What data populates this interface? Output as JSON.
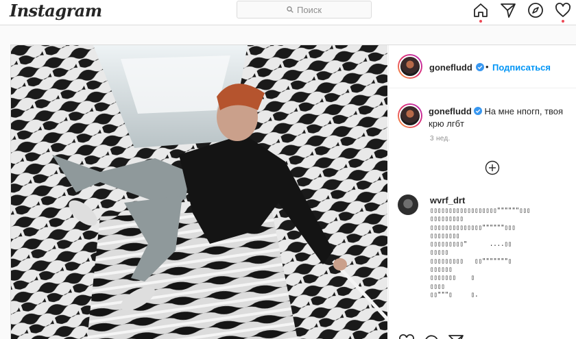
{
  "app": {
    "logo": "Instagram"
  },
  "search": {
    "placeholder": "Поиск"
  },
  "nav": {
    "icons": [
      "home-icon",
      "direct-icon",
      "explore-icon",
      "activity-heart-icon"
    ]
  },
  "colors": {
    "accent": "#0095f6",
    "notification": "#ed4956",
    "border": "#dbdbdb"
  },
  "post": {
    "author": "gonefludd",
    "follow_label": "Подписаться",
    "bullet": "•",
    "caption_user": "gonefludd",
    "caption_text": "На мне нпогп, твоя крю лгбт",
    "time": "3 нед."
  },
  "comment": {
    "user": "wvrf_drt",
    "ascii_art": "▯▯▯▯▯▯▯▯▯▯▯▯▯▯▯▯▯▯\"\"\"\"\"\"▯▯▯\n▯▯▯▯▯▯▯▯▯\n▯▯▯▯▯▯▯▯▯▯▯▯▯▯\"\"\"\"\"\"▯▯▯\n▯▯▯▯▯▯▯▯\n▯▯▯▯▯▯▯▯▯\"      ....▯▯\n▯▯▯▯▯\n▯▯▯▯▯▯▯▯▯   ▯▯\"\"\"\"\"\"\"▯\n▯▯▯▯▯▯\n▯▯▯▯▯▯▯    ▯\n▯▯▯▯\n▯▯\"\"\"▯     ▯."
  }
}
